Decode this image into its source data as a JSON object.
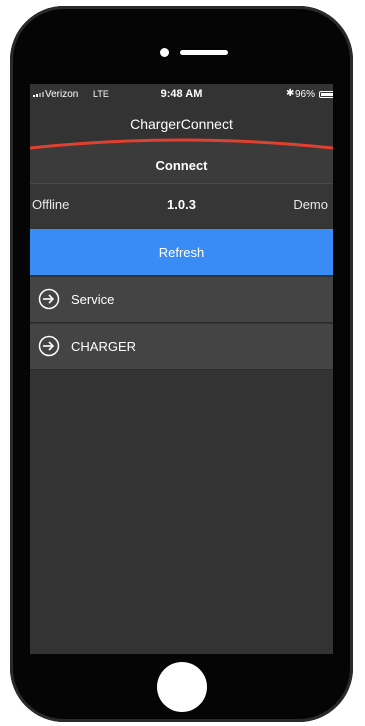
{
  "status_bar": {
    "carrier": "Verizon",
    "network": "LTE",
    "time": "9:48 AM",
    "bluetooth_icon": "bluetooth-icon",
    "battery_percent": "96%",
    "battery_level": 0.96
  },
  "app": {
    "title": "ChargerConnect",
    "accent_color": "#e0402f"
  },
  "connect": {
    "title": "Connect",
    "status": "Offline",
    "version": "1.0.3",
    "mode": "Demo"
  },
  "refresh": {
    "label": "Refresh",
    "color": "#3a8cf5"
  },
  "list": {
    "items": [
      {
        "label": "Service",
        "icon": "enter-arrow-icon"
      },
      {
        "label": "CHARGER",
        "icon": "enter-arrow-icon"
      }
    ]
  }
}
